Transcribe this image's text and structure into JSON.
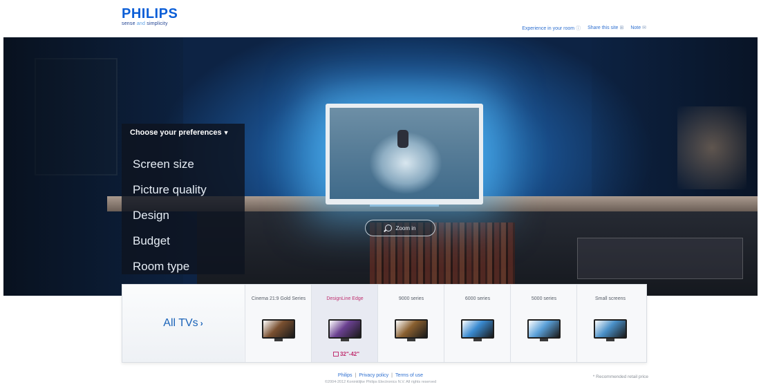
{
  "header": {
    "brand": "PHILIPS",
    "tagline_start": "sense",
    "tagline_and": "and",
    "tagline_end": "simplicity",
    "links": [
      {
        "label": "Experience in your room",
        "icon": "info-icon"
      },
      {
        "label": "Share this site",
        "icon": "share-icon"
      },
      {
        "label": "Note",
        "icon": "note-icon"
      }
    ]
  },
  "preferences": {
    "heading": "Choose your preferences",
    "items": [
      "Screen size",
      "Picture quality",
      "Design",
      "Budget",
      "Room type"
    ]
  },
  "hero": {
    "zoom_label": "Zoom in"
  },
  "strip": {
    "all_tvs_label": "All TVs",
    "series": [
      {
        "title": "Cinema 21:9 Gold Series",
        "selected": false,
        "thumb_color": "#7a5030"
      },
      {
        "title": "DesignLine Edge",
        "selected": true,
        "thumb_color": "#6a4090",
        "size_tag": "32\"-42\""
      },
      {
        "title": "9000 series",
        "selected": false,
        "thumb_color": "#8a6030"
      },
      {
        "title": "6000 series",
        "selected": false,
        "thumb_color": "#3a8ad0"
      },
      {
        "title": "5000 series",
        "selected": false,
        "thumb_color": "#5aa0d8"
      },
      {
        "title": "Small screens",
        "selected": false,
        "thumb_color": "#4a90c8"
      }
    ]
  },
  "footer": {
    "links": [
      "Philips",
      "Privacy policy",
      "Terms of use"
    ],
    "copyright": "©2004-2012 Koninklijke Philips Electronics N.V. All rights reserved",
    "price_note": "* Recommended retail price"
  }
}
